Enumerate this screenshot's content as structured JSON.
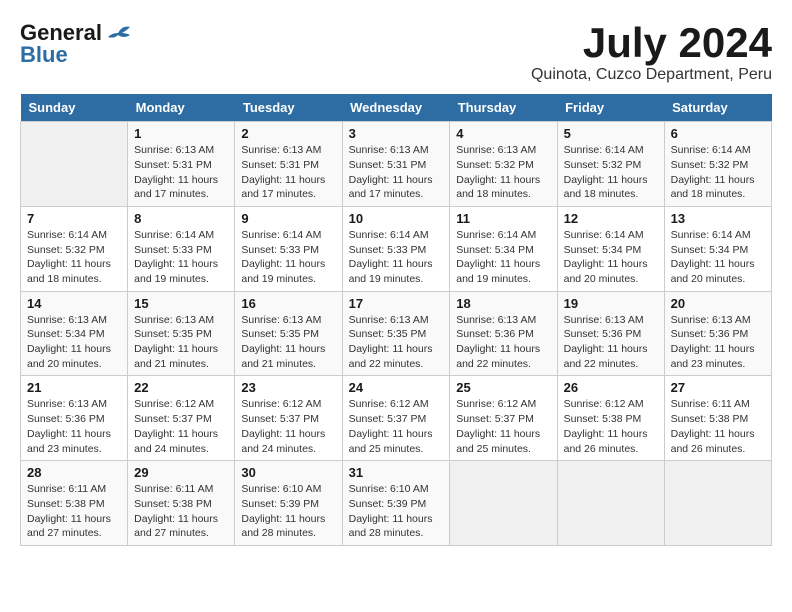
{
  "header": {
    "logo_general": "General",
    "logo_blue": "Blue",
    "month_year": "July 2024",
    "location": "Quinota, Cuzco Department, Peru"
  },
  "calendar": {
    "days_of_week": [
      "Sunday",
      "Monday",
      "Tuesday",
      "Wednesday",
      "Thursday",
      "Friday",
      "Saturday"
    ],
    "weeks": [
      [
        {
          "day": "",
          "info": ""
        },
        {
          "day": "1",
          "info": "Sunrise: 6:13 AM\nSunset: 5:31 PM\nDaylight: 11 hours\nand 17 minutes."
        },
        {
          "day": "2",
          "info": "Sunrise: 6:13 AM\nSunset: 5:31 PM\nDaylight: 11 hours\nand 17 minutes."
        },
        {
          "day": "3",
          "info": "Sunrise: 6:13 AM\nSunset: 5:31 PM\nDaylight: 11 hours\nand 17 minutes."
        },
        {
          "day": "4",
          "info": "Sunrise: 6:13 AM\nSunset: 5:32 PM\nDaylight: 11 hours\nand 18 minutes."
        },
        {
          "day": "5",
          "info": "Sunrise: 6:14 AM\nSunset: 5:32 PM\nDaylight: 11 hours\nand 18 minutes."
        },
        {
          "day": "6",
          "info": "Sunrise: 6:14 AM\nSunset: 5:32 PM\nDaylight: 11 hours\nand 18 minutes."
        }
      ],
      [
        {
          "day": "7",
          "info": "Sunrise: 6:14 AM\nSunset: 5:32 PM\nDaylight: 11 hours\nand 18 minutes."
        },
        {
          "day": "8",
          "info": "Sunrise: 6:14 AM\nSunset: 5:33 PM\nDaylight: 11 hours\nand 19 minutes."
        },
        {
          "day": "9",
          "info": "Sunrise: 6:14 AM\nSunset: 5:33 PM\nDaylight: 11 hours\nand 19 minutes."
        },
        {
          "day": "10",
          "info": "Sunrise: 6:14 AM\nSunset: 5:33 PM\nDaylight: 11 hours\nand 19 minutes."
        },
        {
          "day": "11",
          "info": "Sunrise: 6:14 AM\nSunset: 5:34 PM\nDaylight: 11 hours\nand 19 minutes."
        },
        {
          "day": "12",
          "info": "Sunrise: 6:14 AM\nSunset: 5:34 PM\nDaylight: 11 hours\nand 20 minutes."
        },
        {
          "day": "13",
          "info": "Sunrise: 6:14 AM\nSunset: 5:34 PM\nDaylight: 11 hours\nand 20 minutes."
        }
      ],
      [
        {
          "day": "14",
          "info": "Sunrise: 6:13 AM\nSunset: 5:34 PM\nDaylight: 11 hours\nand 20 minutes."
        },
        {
          "day": "15",
          "info": "Sunrise: 6:13 AM\nSunset: 5:35 PM\nDaylight: 11 hours\nand 21 minutes."
        },
        {
          "day": "16",
          "info": "Sunrise: 6:13 AM\nSunset: 5:35 PM\nDaylight: 11 hours\nand 21 minutes."
        },
        {
          "day": "17",
          "info": "Sunrise: 6:13 AM\nSunset: 5:35 PM\nDaylight: 11 hours\nand 22 minutes."
        },
        {
          "day": "18",
          "info": "Sunrise: 6:13 AM\nSunset: 5:36 PM\nDaylight: 11 hours\nand 22 minutes."
        },
        {
          "day": "19",
          "info": "Sunrise: 6:13 AM\nSunset: 5:36 PM\nDaylight: 11 hours\nand 22 minutes."
        },
        {
          "day": "20",
          "info": "Sunrise: 6:13 AM\nSunset: 5:36 PM\nDaylight: 11 hours\nand 23 minutes."
        }
      ],
      [
        {
          "day": "21",
          "info": "Sunrise: 6:13 AM\nSunset: 5:36 PM\nDaylight: 11 hours\nand 23 minutes."
        },
        {
          "day": "22",
          "info": "Sunrise: 6:12 AM\nSunset: 5:37 PM\nDaylight: 11 hours\nand 24 minutes."
        },
        {
          "day": "23",
          "info": "Sunrise: 6:12 AM\nSunset: 5:37 PM\nDaylight: 11 hours\nand 24 minutes."
        },
        {
          "day": "24",
          "info": "Sunrise: 6:12 AM\nSunset: 5:37 PM\nDaylight: 11 hours\nand 25 minutes."
        },
        {
          "day": "25",
          "info": "Sunrise: 6:12 AM\nSunset: 5:37 PM\nDaylight: 11 hours\nand 25 minutes."
        },
        {
          "day": "26",
          "info": "Sunrise: 6:12 AM\nSunset: 5:38 PM\nDaylight: 11 hours\nand 26 minutes."
        },
        {
          "day": "27",
          "info": "Sunrise: 6:11 AM\nSunset: 5:38 PM\nDaylight: 11 hours\nand 26 minutes."
        }
      ],
      [
        {
          "day": "28",
          "info": "Sunrise: 6:11 AM\nSunset: 5:38 PM\nDaylight: 11 hours\nand 27 minutes."
        },
        {
          "day": "29",
          "info": "Sunrise: 6:11 AM\nSunset: 5:38 PM\nDaylight: 11 hours\nand 27 minutes."
        },
        {
          "day": "30",
          "info": "Sunrise: 6:10 AM\nSunset: 5:39 PM\nDaylight: 11 hours\nand 28 minutes."
        },
        {
          "day": "31",
          "info": "Sunrise: 6:10 AM\nSunset: 5:39 PM\nDaylight: 11 hours\nand 28 minutes."
        },
        {
          "day": "",
          "info": ""
        },
        {
          "day": "",
          "info": ""
        },
        {
          "day": "",
          "info": ""
        }
      ]
    ]
  }
}
